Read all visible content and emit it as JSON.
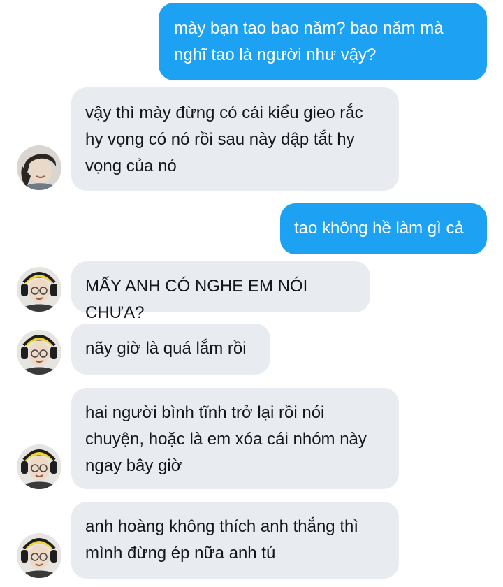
{
  "conversation": {
    "messages": [
      {
        "side": "sent",
        "text": "mày bạn tao bao năm? bao năm mà\nnghĩ tao là người như vậy?"
      },
      {
        "side": "received",
        "avatar": "avatar-a",
        "text": "vậy thì mày đừng có cái kiểu gieo rắc\nhy vọng có nó rồi sau này dập tắt hy\nvọng của nó"
      },
      {
        "side": "sent",
        "text": "tao không hề làm gì cả"
      },
      {
        "side": "received",
        "avatar": "avatar-b",
        "text": "MẤY ANH CÓ NGHE EM NÓI CHƯA?"
      },
      {
        "side": "received",
        "avatar": "avatar-b",
        "text": "nãy giờ là quá lắm rồi"
      },
      {
        "side": "received",
        "avatar": "avatar-b",
        "text": "hai người bình tĩnh trở lại rồi nói\nchuyện, hoặc là em xóa cái nhóm này\nngay bây giờ"
      },
      {
        "side": "received",
        "avatar": "avatar-b",
        "text": "anh hoàng không thích anh thắng thì\nmình đừng ép nữa anh tú"
      }
    ]
  },
  "colors": {
    "sent_bubble": "#1da1f2",
    "received_bubble": "#e8ecf0",
    "sent_text": "#ffffff",
    "received_text": "#14171a"
  }
}
